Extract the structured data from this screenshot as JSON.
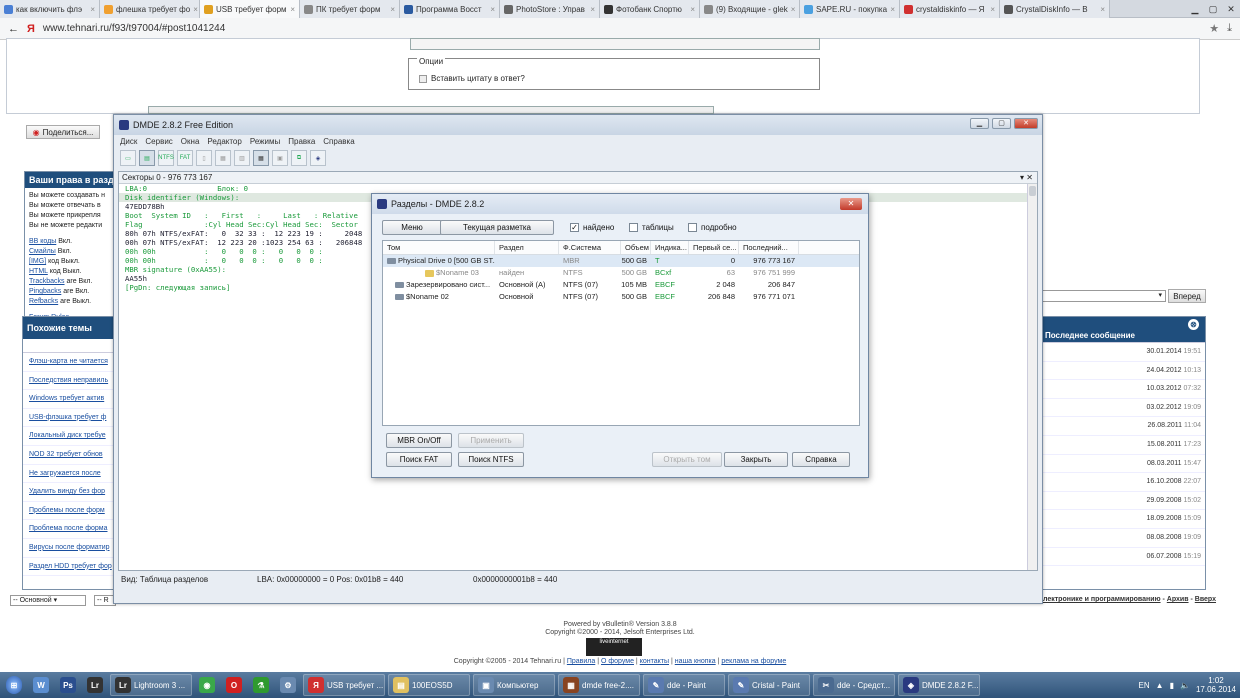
{
  "browser": {
    "tabs": [
      {
        "label": "как включить флэ",
        "color": "#4a7fd4"
      },
      {
        "label": "флешка требует фо",
        "color": "#f0a030"
      },
      {
        "label": "USB требует форм",
        "color": "#e0a020",
        "active": true
      },
      {
        "label": "ПК требует форм",
        "color": "#888888"
      },
      {
        "label": "Программа Восст",
        "color": "#2a5aa0"
      },
      {
        "label": "PhotoStore : Управ",
        "color": "#666666"
      },
      {
        "label": "Фотобанк Спортю",
        "color": "#333333"
      },
      {
        "label": "(9) Входящие - glek",
        "color": "#888888"
      },
      {
        "label": "SAPE.RU - покупка",
        "color": "#4aa0e0"
      },
      {
        "label": "crystaldiskinfo — Я",
        "color": "#d03030"
      },
      {
        "label": "CrystalDiskInfo — В",
        "color": "#555555"
      }
    ],
    "back": "←",
    "logo": "Я",
    "url": "www.tehnari.ru/f93/t97004/#post1041244",
    "star": "★",
    "download": "⤓"
  },
  "forum": {
    "options_title": "Опции",
    "quote_label": "Вставить цитату в ответ?",
    "share_label": "Поделиться...",
    "rights_title": "Ваши права в разделе",
    "rights_lines": [
      "Вы можете создавать н",
      "Вы можете отвечать в",
      "Вы можете прикрепля",
      "Вы не можете редакти"
    ],
    "codes": [
      {
        "name": "BB коды",
        "state": "Вкл."
      },
      {
        "name": "Смайлы",
        "state": "Вкл."
      },
      {
        "name": "[IMG]",
        "state": "код Выкл."
      },
      {
        "name": "HTML",
        "state": "код Выкл."
      },
      {
        "name": "Trackbacks",
        "state": "are Вкл."
      },
      {
        "name": "Pingbacks",
        "state": "are Вкл."
      },
      {
        "name": "Refbacks",
        "state": "are Выкл."
      }
    ],
    "forum_rules": "Forum Rules",
    "similar_title": "Похожие темы",
    "similar": [
      "Флэш-карта не читается",
      "Последствия неправиль",
      "Windows требует актив",
      "USB-флэшка требует ф",
      "Локальный диск требуе",
      "NOD 32 требует обнов",
      "Не загружается после",
      "Удалить винду без фор",
      "Проблемы после форм",
      "Проблема после форма",
      "Вирусы после форматир",
      "Раздел HDD требует фор"
    ],
    "last_msg_title": "Последнее сообщение",
    "last_msgs": [
      {
        "date": "30.01.2014",
        "time": "19:51"
      },
      {
        "date": "24.04.2012",
        "time": "10:13"
      },
      {
        "date": "10.03.2012",
        "time": "07:32"
      },
      {
        "date": "03.02.2012",
        "time": "19:09"
      },
      {
        "date": "26.08.2011",
        "time": "11:04"
      },
      {
        "date": "15.08.2011",
        "time": "17:23"
      },
      {
        "date": "08.03.2011",
        "time": "15:47"
      },
      {
        "date": "16.10.2008",
        "time": "22:07"
      },
      {
        "date": "29.09.2008",
        "time": "15:02"
      },
      {
        "date": "18.09.2008",
        "time": "15:09"
      },
      {
        "date": "08.08.2008",
        "time": "19:09"
      },
      {
        "date": "06.07.2008",
        "time": "15:19"
      }
    ],
    "forward": "Вперед",
    "style_select": "-- Основной",
    "lang_select": "-- R",
    "bottom_links": "лектронике и программированию",
    "archive": "Архив",
    "top": "Вверх",
    "powered": "Powered by vBulletin® Version 3.8.8",
    "copyright1": "Copyright ©2000 - 2014, Jelsoft Enterprises Ltd.",
    "counter": "liveinternet",
    "copyright2": "Copyright ©2005 - 2014 Tehnari.ru",
    "footer_links": [
      "Правила",
      "О форуме",
      "контакты",
      "наша кнопка",
      "реклама на форуме"
    ]
  },
  "dmde": {
    "title": "DMDE 2.8.2 Free Edition",
    "menu": [
      "Диск",
      "Сервис",
      "Окна",
      "Редактор",
      "Режимы",
      "Правка",
      "Справка"
    ],
    "pane_title": "Секторы 0 - 976 773 167",
    "lines": [
      {
        "t": "LBA:0                Блок: 0",
        "c": "g"
      },
      {
        "t": "Disk identifier (Windows):",
        "c": "gs"
      },
      {
        "t": "47EDD78Bh",
        "c": ""
      },
      {
        "t": "Boot  System ID   :   First   :     Last   : Relative",
        "c": "g"
      },
      {
        "t": "Flag              :Cyl Head Sec:Cyl Head Sec:  Sector",
        "c": "g"
      },
      {
        "t": "80h 07h NTFS/exFAT:   0  32 33 :  12 223 19 :     2048",
        "c": ""
      },
      {
        "t": "00h 07h NTFS/exFAT:  12 223 20 :1023 254 63 :   206848",
        "c": ""
      },
      {
        "t": "00h 00h           :   0   0  0 :   0   0  0 :",
        "c": "g"
      },
      {
        "t": "00h 00h           :   0   0  0 :   0   0  0 :",
        "c": "g"
      },
      {
        "t": "MBR signature (0xAA55):",
        "c": "g"
      },
      {
        "t": "AA55h",
        "c": ""
      },
      {
        "t": "[PgDn: следующая запись]",
        "c": "g"
      }
    ],
    "status": {
      "view": "Вид: Таблица разделов",
      "lba": "LBA: 0x00000000 = 0  Pos: 0x01b8 = 440",
      "off": "0x0000000001b8 = 440"
    }
  },
  "dialog": {
    "title": "Разделы - DMDE 2.8.2",
    "menu_btn": "Меню",
    "layout_btn": "Текущая разметка",
    "found_label": "найдено",
    "tables_label": "таблицы",
    "detail_label": "подробно",
    "columns": [
      "Том",
      "Раздел",
      "Ф.Система",
      "Объем",
      "Индика...",
      "Первый се...",
      "Последний..."
    ],
    "rows": [
      {
        "vol": "Physical Drive 0 [500 GB ST...",
        "part": "",
        "fs": "MBR",
        "size": "500 GB",
        "ind": "T",
        "first": "0",
        "last": "976 773 167",
        "sel": true,
        "icon": "drive"
      },
      {
        "vol": "$Noname 03",
        "part": "найден",
        "fs": "NTFS",
        "size": "500 GB",
        "ind": "BCxf",
        "first": "63",
        "last": "976 751 999",
        "sel": false,
        "icon": "folder",
        "grey": true
      },
      {
        "vol": "Зарезервировано сист...",
        "part": "Основной (A)",
        "fs": "NTFS (07)",
        "size": "105 MB",
        "ind": "EBCF",
        "first": "2 048",
        "last": "206 847",
        "sel": false,
        "icon": "drive"
      },
      {
        "vol": "$Noname 02",
        "part": "Основной",
        "fs": "NTFS (07)",
        "size": "500 GB",
        "ind": "EBCF",
        "first": "206 848",
        "last": "976 771 071",
        "sel": false,
        "icon": "drive"
      }
    ],
    "mbr_btn": "MBR On/Off",
    "apply_btn": "Применить",
    "fat_btn": "Поиск FAT",
    "ntfs_btn": "Поиск NTFS",
    "open_btn": "Открыть том",
    "close_btn": "Закрыть",
    "help_btn": "Справка"
  },
  "taskbar": {
    "items": [
      {
        "label": "",
        "color": "#5b8ed0",
        "glyph": "W"
      },
      {
        "label": "",
        "color": "#2a4e8e",
        "glyph": "Ps"
      },
      {
        "label": "",
        "color": "#333333",
        "glyph": "Lr"
      },
      {
        "label": "Lightroom 3 ...",
        "color": "#333333",
        "glyph": "Lr",
        "wide": true
      },
      {
        "label": "",
        "color": "#3aa84a",
        "glyph": "◉"
      },
      {
        "label": "",
        "color": "#d02020",
        "glyph": "O"
      },
      {
        "label": "",
        "color": "#2f9a2f",
        "glyph": "⚗"
      },
      {
        "label": "",
        "color": "#6a8ab0",
        "glyph": "⚙"
      },
      {
        "label": "USB требует ...",
        "color": "#d03030",
        "glyph": "Я",
        "wide": true
      },
      {
        "label": "100EOS5D",
        "color": "#e0c060",
        "glyph": "▤",
        "wide": true
      },
      {
        "label": "Компьютер",
        "color": "#6a8ab0",
        "glyph": "▣",
        "wide": true
      },
      {
        "label": "dmde free-2....",
        "color": "#884422",
        "glyph": "▦",
        "wide": true
      },
      {
        "label": "dde - Paint",
        "color": "#5a7ab0",
        "glyph": "✎",
        "wide": true
      },
      {
        "label": "Cristal - Paint",
        "color": "#5a7ab0",
        "glyph": "✎",
        "wide": true
      },
      {
        "label": "dde - Средст...",
        "color": "#4a6a90",
        "glyph": "✂",
        "wide": true
      },
      {
        "label": "DMDE 2.8.2 F...",
        "color": "#2a3a80",
        "glyph": "◈",
        "wide": true
      }
    ],
    "lang": "EN",
    "time": "1:02",
    "date": "17.06.2014"
  }
}
